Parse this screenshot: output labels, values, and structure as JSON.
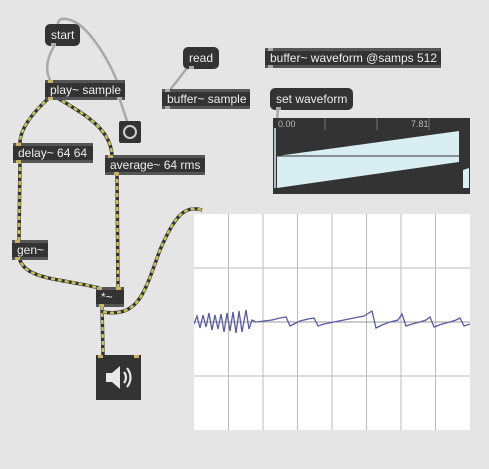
{
  "messages": {
    "start": "start",
    "read": "read",
    "set_waveform": "set waveform"
  },
  "objects": {
    "play": "play~ sample",
    "buffer": "buffer~ sample",
    "buffer_waveform": "buffer~ waveform @samps 512",
    "delay": "delay~ 64 64",
    "average": "average~ 64 rms",
    "gen": "gen~",
    "multiply": "*~"
  },
  "waveform": {
    "label_start": "0.00",
    "label_end": "7.81"
  },
  "icons": {
    "speaker": "speaker-icon",
    "bang": "bang-icon"
  },
  "colors": {
    "patch_background": "#e5e5e5",
    "object_fill": "#333333",
    "signal_cord": "#c9c45a",
    "control_cord": "#a9a9a9",
    "waveform_fill": "#d9eef2",
    "scope_trace": "#5a5aa5"
  }
}
